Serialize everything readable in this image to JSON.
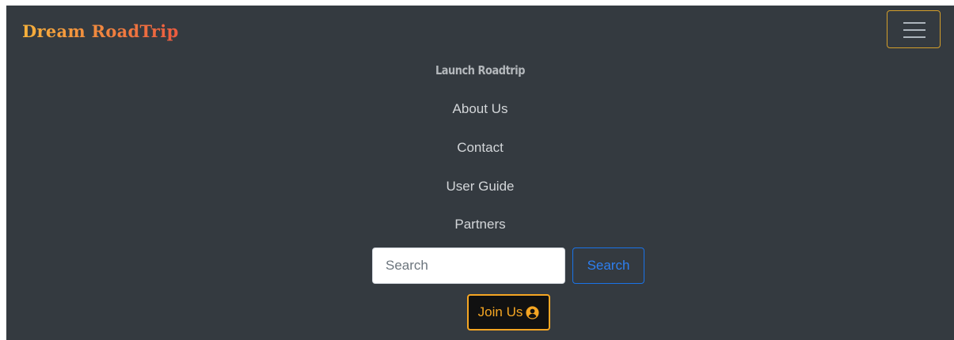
{
  "brand": {
    "title": "Dream RoadTrip"
  },
  "navbar": {
    "toggler_icon": "hamburger-menu-icon",
    "items": [
      {
        "label": "Launch Roadtrip"
      },
      {
        "label": "About Us"
      },
      {
        "label": "Contact"
      },
      {
        "label": "User Guide"
      },
      {
        "label": "Partners"
      }
    ]
  },
  "search": {
    "placeholder": "Search",
    "value": "",
    "button_label": "Search"
  },
  "join": {
    "label": "Join Us",
    "icon": "user-circle-icon"
  },
  "colors": {
    "navbar_bg": "#343a40",
    "accent_orange": "#f5a623",
    "search_blue": "#2d7ff0"
  }
}
